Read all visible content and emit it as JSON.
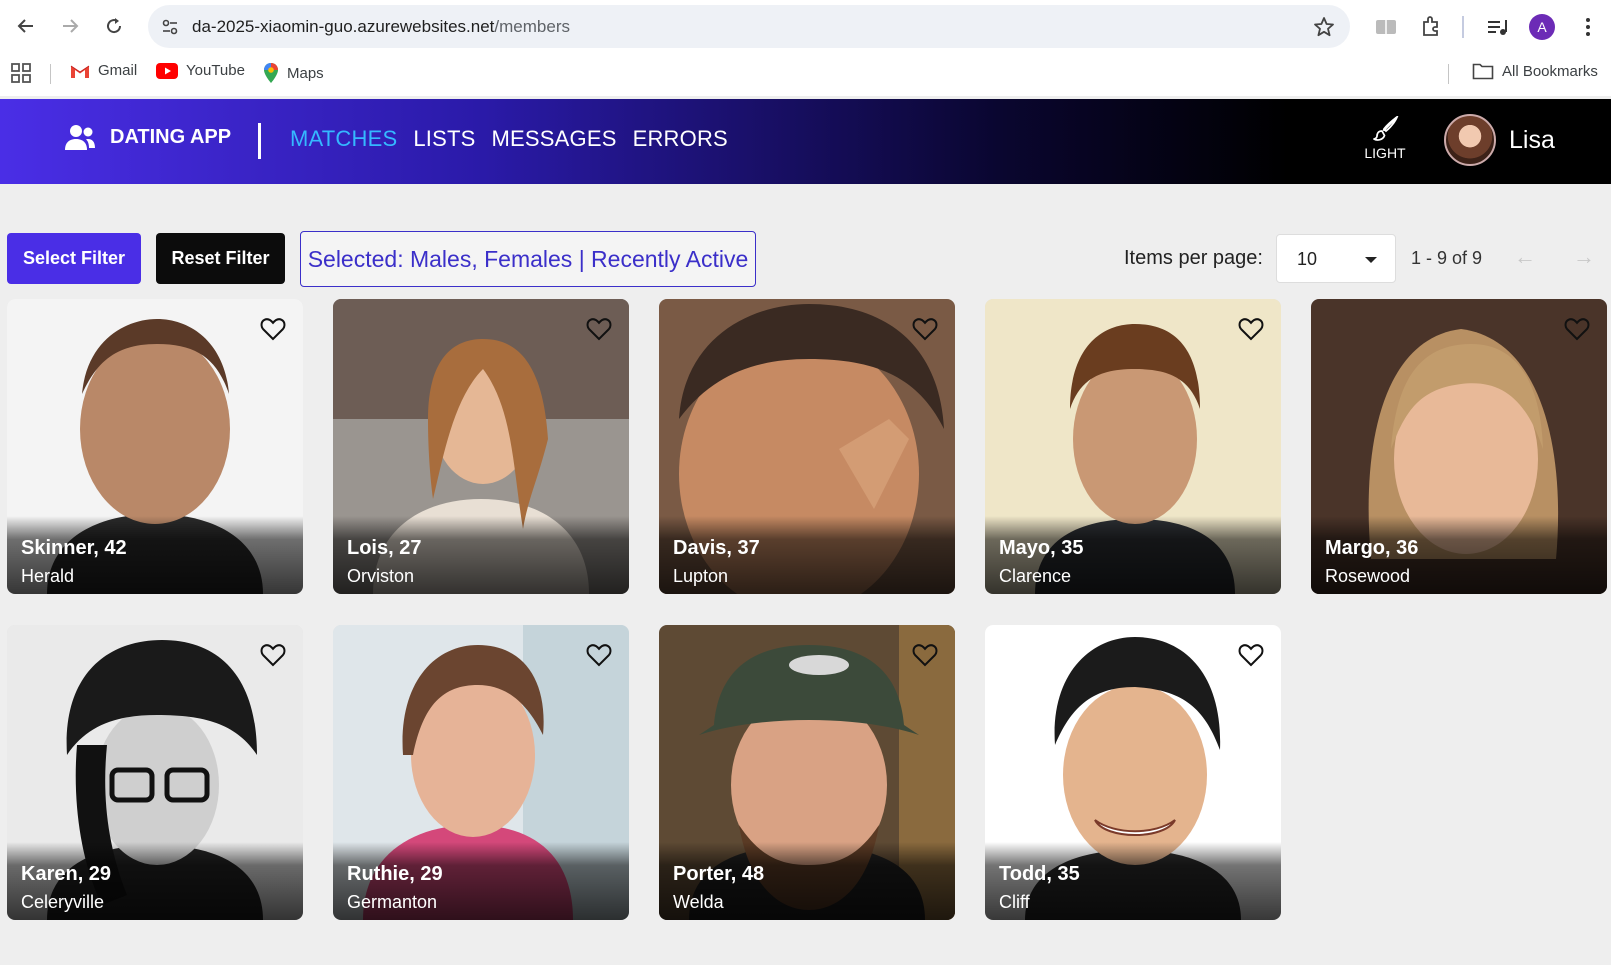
{
  "browser": {
    "url_host": "da-2025-xiaomin-guo.azurewebsites.net",
    "url_path": "/members",
    "profile_initial": "A",
    "bookmarks": [
      {
        "label": "Gmail",
        "icon": "gmail-icon"
      },
      {
        "label": "YouTube",
        "icon": "youtube-icon"
      },
      {
        "label": "Maps",
        "icon": "maps-icon"
      }
    ],
    "all_bookmarks": "All Bookmarks"
  },
  "navbar": {
    "brand": "DATING APP",
    "links": [
      {
        "label": "MATCHES",
        "active": true
      },
      {
        "label": "LISTS",
        "active": false
      },
      {
        "label": "MESSAGES",
        "active": false
      },
      {
        "label": "ERRORS",
        "active": false
      }
    ],
    "theme_label": "LIGHT",
    "user_name": "Lisa"
  },
  "toolbar": {
    "select_filter": "Select Filter",
    "reset_filter": "Reset Filter",
    "selected_text": "Selected: Males, Females | Recently Active",
    "items_per_page_label": "Items per page:",
    "items_per_page_value": "10",
    "range_label": "1 - 9 of 9",
    "prev_arrow": "←",
    "next_arrow": "→"
  },
  "members": [
    {
      "name": "Skinner, 42",
      "city": "Herald"
    },
    {
      "name": "Lois, 27",
      "city": "Orviston"
    },
    {
      "name": "Davis, 37",
      "city": "Lupton"
    },
    {
      "name": "Mayo, 35",
      "city": "Clarence"
    },
    {
      "name": "Margo, 36",
      "city": "Rosewood"
    },
    {
      "name": "Karen, 29",
      "city": "Celeryville"
    },
    {
      "name": "Ruthie, 29",
      "city": "Germanton"
    },
    {
      "name": "Porter, 48",
      "city": "Welda"
    },
    {
      "name": "Todd, 35",
      "city": "Cliff"
    }
  ],
  "colors": {
    "accent": "#4a2ee6",
    "active_link": "#35b8ff",
    "selected_text": "#3b2fc9"
  }
}
